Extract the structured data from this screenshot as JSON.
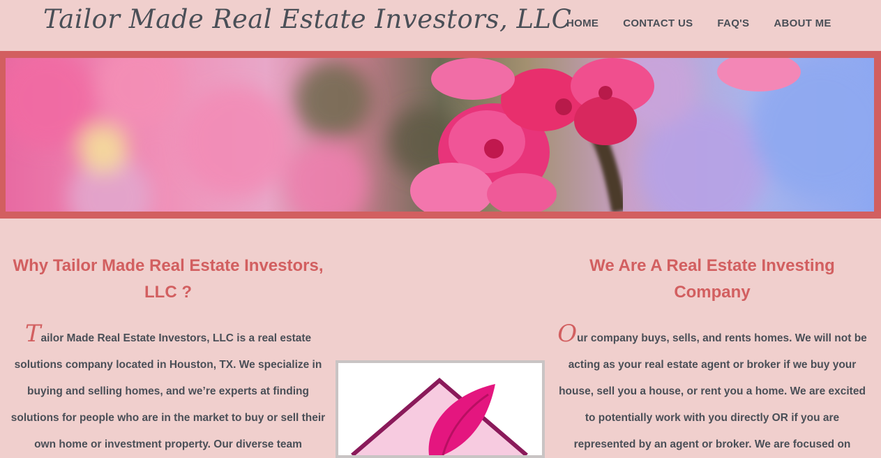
{
  "header": {
    "site_title": "Tailor Made Real Estate Investors, LLC",
    "nav": [
      {
        "label": "HOME"
      },
      {
        "label": "CONTACT US"
      },
      {
        "label": "FAQ'S"
      },
      {
        "label": "ABOUT ME"
      }
    ]
  },
  "banner": {
    "icon": "cherry-blossom-photo"
  },
  "left_section": {
    "heading": "Why Tailor Made Real Estate Investors, LLC ?",
    "dropcap": "T",
    "body": "ailor Made Real Estate Investors, LLC is a real estate solutions company located in Houston, TX. We specialize in buying and selling homes, and we’re experts at finding solutions for people who are in the market to buy or sell their own home or investment property. Our diverse team"
  },
  "right_section": {
    "heading": "We Are A Real Estate Investing Company",
    "dropcap": "O",
    "body": "ur company buys, sells, and rents homes. We will not be acting as your real estate agent or broker if we buy your house, sell you a house, or rent you a home. We are excited to potentially work with you directly OR if you are represented by an agent or broker. We are focused on"
  },
  "logo": {
    "icon": "house-leaf-logo"
  },
  "colors": {
    "background": "#f0cfcd",
    "accent": "#d25f60",
    "text": "#4a4f57"
  }
}
